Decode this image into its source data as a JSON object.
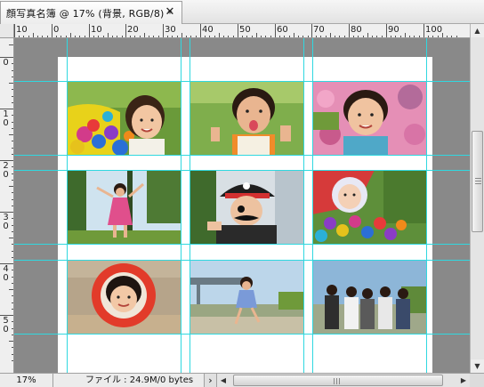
{
  "document": {
    "tab_title": "顔写真名簿 @ 17% (背景, RGB/8) *",
    "close_symbol": "✕"
  },
  "rulers": {
    "horizontal_labels": [
      "10",
      "0",
      "10",
      "20",
      "30",
      "40",
      "50",
      "60",
      "70",
      "80",
      "90",
      "100"
    ],
    "vertical_labels": [
      "0",
      "1\n0",
      "2\n0",
      "3\n0",
      "4\n0",
      "5\n0"
    ]
  },
  "photos": [
    {
      "row": 1,
      "col": 1,
      "subject": "child in ball pit",
      "icon": "photo-thumbnail"
    },
    {
      "row": 1,
      "col": 2,
      "subject": "boy sticking out tongue",
      "icon": "photo-thumbnail"
    },
    {
      "row": 1,
      "col": 3,
      "subject": "boy with flowers",
      "icon": "photo-thumbnail"
    },
    {
      "row": 2,
      "col": 1,
      "subject": "girl in park",
      "icon": "photo-thumbnail"
    },
    {
      "row": 2,
      "col": 2,
      "subject": "child in pirate hat",
      "icon": "photo-thumbnail"
    },
    {
      "row": 2,
      "col": 3,
      "subject": "baby in ball pit",
      "icon": "photo-thumbnail"
    },
    {
      "row": 3,
      "col": 1,
      "subject": "girl in red ring",
      "icon": "photo-thumbnail"
    },
    {
      "row": 3,
      "col": 2,
      "subject": "child running",
      "icon": "photo-thumbnail"
    },
    {
      "row": 3,
      "col": 3,
      "subject": "group of friends",
      "icon": "photo-thumbnail"
    }
  ],
  "status_bar": {
    "zoom": "17%",
    "file_info": "ファイル : 24.9M/0 bytes",
    "menu_arrow": "›"
  },
  "colors": {
    "guide": "#30d8e0",
    "pasteboard": "#898989",
    "page": "#ffffff"
  }
}
